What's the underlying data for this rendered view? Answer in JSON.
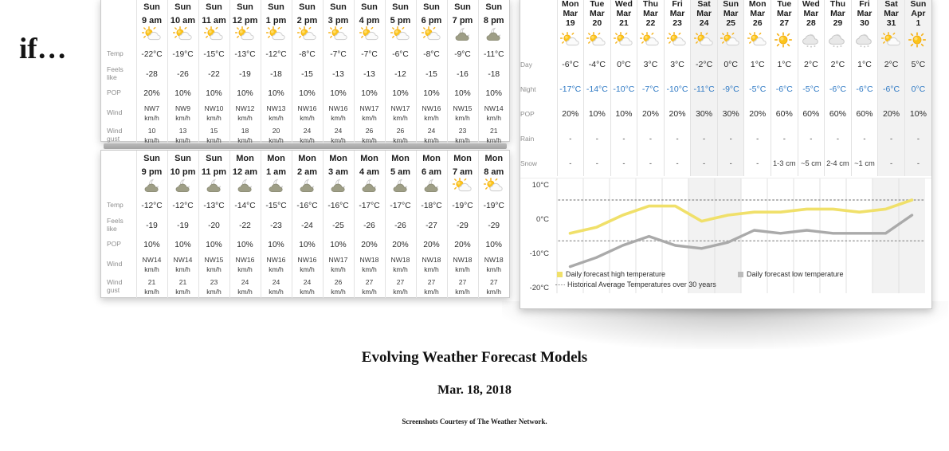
{
  "overlay": {
    "if_text": "if…"
  },
  "caption": {
    "title": "Evolving Weather Forecast Models",
    "date": "Mar. 18, 2018",
    "credit": "Screenshots Courtesy of The Weather Network."
  },
  "hourly_panel_1": {
    "row_labels": [
      "Temp",
      "Feels like",
      "POP",
      "Wind",
      "Wind gust"
    ],
    "columns": [
      {
        "day": "Sun",
        "time": "9 am",
        "icon": "sun-cloud-icon",
        "temp": "-22°C",
        "feels": "-28",
        "pop": "20%",
        "wind": "NW7 km/h",
        "gust": "10 km/h"
      },
      {
        "day": "Sun",
        "time": "10 am",
        "icon": "sun-cloud-icon",
        "temp": "-19°C",
        "feels": "-26",
        "pop": "10%",
        "wind": "NW9 km/h",
        "gust": "13 km/h"
      },
      {
        "day": "Sun",
        "time": "11 am",
        "icon": "sun-cloud-icon",
        "temp": "-15°C",
        "feels": "-22",
        "pop": "10%",
        "wind": "NW10 km/h",
        "gust": "15 km/h"
      },
      {
        "day": "Sun",
        "time": "12 pm",
        "icon": "sun-cloud-icon",
        "temp": "-13°C",
        "feels": "-19",
        "pop": "10%",
        "wind": "NW12 km/h",
        "gust": "18 km/h"
      },
      {
        "day": "Sun",
        "time": "1 pm",
        "icon": "sun-cloud-icon",
        "temp": "-12°C",
        "feels": "-18",
        "pop": "10%",
        "wind": "NW13 km/h",
        "gust": "20 km/h"
      },
      {
        "day": "Sun",
        "time": "2 pm",
        "icon": "sun-cloud-icon",
        "temp": "-8°C",
        "feels": "-15",
        "pop": "10%",
        "wind": "NW16 km/h",
        "gust": "24 km/h"
      },
      {
        "day": "Sun",
        "time": "3 pm",
        "icon": "sun-cloud-icon",
        "temp": "-7°C",
        "feels": "-13",
        "pop": "10%",
        "wind": "NW16 km/h",
        "gust": "24 km/h"
      },
      {
        "day": "Sun",
        "time": "4 pm",
        "icon": "sun-cloud-icon",
        "temp": "-7°C",
        "feels": "-13",
        "pop": "10%",
        "wind": "NW17 km/h",
        "gust": "26 km/h"
      },
      {
        "day": "Sun",
        "time": "5 pm",
        "icon": "sun-cloud-icon",
        "temp": "-6°C",
        "feels": "-12",
        "pop": "10%",
        "wind": "NW17 km/h",
        "gust": "26 km/h"
      },
      {
        "day": "Sun",
        "time": "6 pm",
        "icon": "sun-cloud-icon",
        "temp": "-8°C",
        "feels": "-15",
        "pop": "10%",
        "wind": "NW16 km/h",
        "gust": "24 km/h"
      },
      {
        "day": "Sun",
        "time": "7 pm",
        "icon": "moon-cloud-icon",
        "temp": "-9°C",
        "feels": "-16",
        "pop": "10%",
        "wind": "NW15 km/h",
        "gust": "23 km/h"
      },
      {
        "day": "Sun",
        "time": "8 pm",
        "icon": "moon-cloud-icon",
        "temp": "-11°C",
        "feels": "-18",
        "pop": "10%",
        "wind": "NW14 km/h",
        "gust": "21 km/h"
      }
    ]
  },
  "hourly_panel_2": {
    "row_labels": [
      "Temp",
      "Feels like",
      "POP",
      "Wind",
      "Wind gust"
    ],
    "columns": [
      {
        "day": "Sun",
        "time": "9 pm",
        "icon": "moon-cloud-icon",
        "temp": "-12°C",
        "feels": "-19",
        "pop": "10%",
        "wind": "NW14 km/h",
        "gust": "21 km/h"
      },
      {
        "day": "Sun",
        "time": "10 pm",
        "icon": "moon-cloud-icon",
        "temp": "-12°C",
        "feels": "-19",
        "pop": "10%",
        "wind": "NW14 km/h",
        "gust": "21 km/h"
      },
      {
        "day": "Sun",
        "time": "11 pm",
        "icon": "moon-cloud-icon",
        "temp": "-13°C",
        "feels": "-20",
        "pop": "10%",
        "wind": "NW15 km/h",
        "gust": "23 km/h"
      },
      {
        "day": "Mon",
        "time": "12 am",
        "icon": "moon-cloud-icon",
        "temp": "-14°C",
        "feels": "-22",
        "pop": "10%",
        "wind": "NW16 km/h",
        "gust": "24 km/h"
      },
      {
        "day": "Mon",
        "time": "1 am",
        "icon": "moon-cloud-icon",
        "temp": "-15°C",
        "feels": "-23",
        "pop": "10%",
        "wind": "NW16 km/h",
        "gust": "24 km/h"
      },
      {
        "day": "Mon",
        "time": "2 am",
        "icon": "moon-cloud-icon",
        "temp": "-16°C",
        "feels": "-24",
        "pop": "10%",
        "wind": "NW16 km/h",
        "gust": "24 km/h"
      },
      {
        "day": "Mon",
        "time": "3 am",
        "icon": "moon-cloud-icon",
        "temp": "-16°C",
        "feels": "-25",
        "pop": "10%",
        "wind": "NW17 km/h",
        "gust": "26 km/h"
      },
      {
        "day": "Mon",
        "time": "4 am",
        "icon": "moon-cloud-icon",
        "temp": "-17°C",
        "feels": "-26",
        "pop": "20%",
        "wind": "NW18 km/h",
        "gust": "27 km/h"
      },
      {
        "day": "Mon",
        "time": "5 am",
        "icon": "moon-cloud-icon",
        "temp": "-17°C",
        "feels": "-26",
        "pop": "20%",
        "wind": "NW18 km/h",
        "gust": "27 km/h"
      },
      {
        "day": "Mon",
        "time": "6 am",
        "icon": "moon-cloud-icon",
        "temp": "-18°C",
        "feels": "-27",
        "pop": "20%",
        "wind": "NW18 km/h",
        "gust": "27 km/h"
      },
      {
        "day": "Mon",
        "time": "7 am",
        "icon": "sun-cloud-icon",
        "temp": "-19°C",
        "feels": "-29",
        "pop": "20%",
        "wind": "NW18 km/h",
        "gust": "27 km/h"
      },
      {
        "day": "Mon",
        "time": "8 am",
        "icon": "sun-cloud-icon",
        "temp": "-19°C",
        "feels": "-29",
        "pop": "10%",
        "wind": "NW18 km/h",
        "gust": "27 km/h"
      }
    ]
  },
  "daily_panel": {
    "row_labels": [
      "Day",
      "Night",
      "POP",
      "Rain",
      "Snow"
    ],
    "columns": [
      {
        "day": "Mon",
        "month": "Mar",
        "date": "19",
        "weekend": false,
        "icon": "sun-cloud-icon",
        "day_temp": "-6°C",
        "night_temp": "-17°C",
        "pop": "20%",
        "rain": "-",
        "snow": "-"
      },
      {
        "day": "Tue",
        "month": "Mar",
        "date": "20",
        "weekend": false,
        "icon": "sun-cloud-icon",
        "day_temp": "-4°C",
        "night_temp": "-14°C",
        "pop": "10%",
        "rain": "-",
        "snow": "-"
      },
      {
        "day": "Wed",
        "month": "Mar",
        "date": "21",
        "weekend": false,
        "icon": "sun-cloud-icon",
        "day_temp": "0°C",
        "night_temp": "-10°C",
        "pop": "10%",
        "rain": "-",
        "snow": "-"
      },
      {
        "day": "Thu",
        "month": "Mar",
        "date": "22",
        "weekend": false,
        "icon": "sun-cloud-icon",
        "day_temp": "3°C",
        "night_temp": "-7°C",
        "pop": "20%",
        "rain": "-",
        "snow": "-"
      },
      {
        "day": "Fri",
        "month": "Mar",
        "date": "23",
        "weekend": false,
        "icon": "sun-cloud-icon",
        "day_temp": "3°C",
        "night_temp": "-10°C",
        "pop": "20%",
        "rain": "-",
        "snow": "-"
      },
      {
        "day": "Sat",
        "month": "Mar",
        "date": "24",
        "weekend": true,
        "icon": "sun-cloud-icon",
        "day_temp": "-2°C",
        "night_temp": "-11°C",
        "pop": "30%",
        "rain": "-",
        "snow": "-"
      },
      {
        "day": "Sun",
        "month": "Mar",
        "date": "25",
        "weekend": true,
        "icon": "sun-cloud-icon",
        "day_temp": "0°C",
        "night_temp": "-9°C",
        "pop": "30%",
        "rain": "-",
        "snow": "-"
      },
      {
        "day": "Mon",
        "month": "Mar",
        "date": "26",
        "weekend": false,
        "icon": "sun-cloud-icon",
        "day_temp": "1°C",
        "night_temp": "-5°C",
        "pop": "20%",
        "rain": "-",
        "snow": "-"
      },
      {
        "day": "Tue",
        "month": "Mar",
        "date": "27",
        "weekend": false,
        "icon": "sun-icon",
        "day_temp": "1°C",
        "night_temp": "-6°C",
        "pop": "60%",
        "rain": "-",
        "snow": "1-3 cm"
      },
      {
        "day": "Wed",
        "month": "Mar",
        "date": "28",
        "weekend": false,
        "icon": "cloud-snow-icon",
        "day_temp": "2°C",
        "night_temp": "-5°C",
        "pop": "60%",
        "rain": "-",
        "snow": "~5 cm"
      },
      {
        "day": "Thu",
        "month": "Mar",
        "date": "29",
        "weekend": false,
        "icon": "cloud-snow-icon",
        "day_temp": "2°C",
        "night_temp": "-6°C",
        "pop": "60%",
        "rain": "-",
        "snow": "2-4 cm"
      },
      {
        "day": "Fri",
        "month": "Mar",
        "date": "30",
        "weekend": false,
        "icon": "cloud-snow-icon",
        "day_temp": "1°C",
        "night_temp": "-6°C",
        "pop": "60%",
        "rain": "-",
        "snow": "~1 cm"
      },
      {
        "day": "Sat",
        "month": "Mar",
        "date": "31",
        "weekend": true,
        "icon": "sun-cloud-icon",
        "day_temp": "2°C",
        "night_temp": "-6°C",
        "pop": "20%",
        "rain": "-",
        "snow": "-"
      },
      {
        "day": "Sun",
        "month": "Apr",
        "date": "1",
        "weekend": true,
        "icon": "sun-icon",
        "day_temp": "5°C",
        "night_temp": "0°C",
        "pop": "10%",
        "rain": "-",
        "snow": "-"
      }
    ]
  },
  "chart_data": {
    "type": "line",
    "title": "",
    "xlabel": "",
    "ylabel": "",
    "ylim": [
      -20,
      10
    ],
    "yticks": [
      10,
      0,
      -10,
      -20
    ],
    "ytick_labels": [
      "10°C",
      "0°C",
      "-10°C",
      "-20°C"
    ],
    "grid": true,
    "legend_position": "bottom",
    "x": [
      "Mar 19",
      "Mar 20",
      "Mar 21",
      "Mar 22",
      "Mar 23",
      "Mar 24",
      "Mar 25",
      "Mar 26",
      "Mar 27",
      "Mar 28",
      "Mar 29",
      "Mar 30",
      "Mar 31",
      "Apr 1"
    ],
    "series": [
      {
        "name": "Daily forecast high temperature",
        "color": "#f0e06a",
        "style": "solid",
        "values": [
          -6,
          -4,
          0,
          3,
          3,
          -2,
          0,
          1,
          1,
          2,
          2,
          1,
          2,
          5
        ]
      },
      {
        "name": "Daily forecast low temperature",
        "color": "#aaaaaa",
        "style": "solid",
        "values": [
          -17,
          -14,
          -10,
          -7,
          -10,
          -11,
          -9,
          -5,
          -6,
          -5,
          -6,
          -6,
          -6,
          0
        ]
      },
      {
        "name": "Historical Average Temperatures over 30 years",
        "color": "#8e8e8e",
        "style": "dotted",
        "values": [
          5,
          5,
          5,
          5,
          5,
          5,
          5,
          5,
          5,
          5,
          5,
          5,
          5,
          5
        ]
      },
      {
        "name": "Historical Average Temperatures over 30 years (low)",
        "color": "#8e8e8e",
        "style": "dotted",
        "values": [
          -8.5,
          -8.5,
          -8.5,
          -8.5,
          -8.5,
          -8.5,
          -8.5,
          -8.5,
          -8.5,
          -8.5,
          -8.5,
          -8.5,
          -8.5,
          -8.5
        ]
      }
    ],
    "legend": [
      {
        "label": "Daily forecast high temperature",
        "swatch": "#f0e06a",
        "kind": "swatch"
      },
      {
        "label": "Daily forecast low temperature",
        "swatch": "#bbbbbb",
        "kind": "swatch"
      },
      {
        "label": "Historical Average Temperatures over 30 years",
        "swatch": "#8e8e8e",
        "kind": "dots"
      }
    ],
    "weekend_bands": [
      [
        5,
        7
      ],
      [
        12,
        14
      ]
    ]
  },
  "colors": {
    "night_temp": "#2e79c4",
    "high_line": "#f0e06a",
    "low_line": "#aaaaaa",
    "weekend_band": "#f2f2f2",
    "row_label": "#8e8e8e"
  }
}
